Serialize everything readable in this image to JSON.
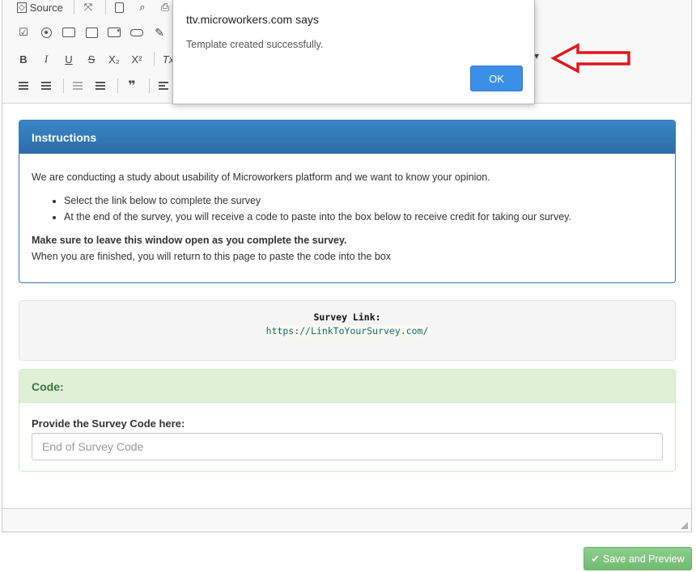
{
  "toolbar": {
    "source_label": "Source",
    "bold": "B",
    "italic": "I",
    "underline": "U",
    "strike": "S",
    "subscript": "X₂",
    "superscript": "X²",
    "remove_format": "Tx",
    "blockquote": "❞"
  },
  "dialog": {
    "title": "ttv.microworkers.com says",
    "message": "Template created successfully.",
    "ok_label": "OK"
  },
  "instructions": {
    "heading": "Instructions",
    "intro": "We are conducting a study about usability of Microworkers platform and we want to know your opinion.",
    "bullets": [
      "Select the link below to complete the survey",
      "At the end of the survey, you will receive a code to paste into the box below to receive credit for taking our survey."
    ],
    "warning": "Make sure to leave this window open as you complete the survey.",
    "finish_note": "When you are finished, you will return to this page to paste the code into the box"
  },
  "survey": {
    "label": "Survey Link:",
    "url": "https://LinkToYourSurvey.com/"
  },
  "code": {
    "heading": "Code:",
    "field_label": "Provide the Survey Code here:",
    "placeholder": "End of Survey Code"
  },
  "actions": {
    "save_label": "Save and Preview"
  },
  "colors": {
    "instructions_header": "#337ab7",
    "code_header": "#dff0d8",
    "ok_button": "#3b8fe6",
    "save_button": "#7cc47c",
    "arrow": "#e0161b"
  }
}
